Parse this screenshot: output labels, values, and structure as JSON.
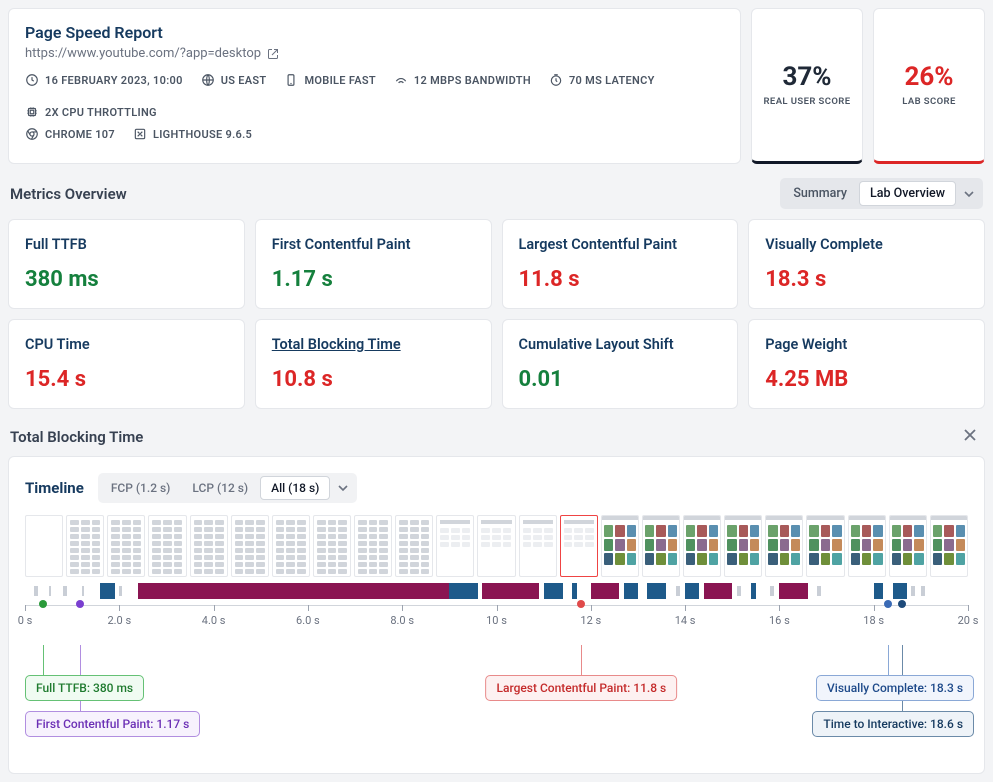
{
  "header": {
    "title": "Page Speed Report",
    "url": "https://www.youtube.com/?app=desktop",
    "meta1": [
      {
        "icon": "clock",
        "text": "16 FEBRUARY 2023, 10:00"
      },
      {
        "icon": "globe",
        "text": "US EAST"
      },
      {
        "icon": "device",
        "text": "MOBILE FAST"
      },
      {
        "icon": "speed",
        "text": "12 MBPS BANDWIDTH"
      },
      {
        "icon": "latency",
        "text": "70 MS LATENCY"
      },
      {
        "icon": "cpu",
        "text": "2X CPU THROTTLING"
      }
    ],
    "meta2": [
      {
        "icon": "chrome",
        "text": "CHROME 107"
      },
      {
        "icon": "lighthouse",
        "text": "LIGHTHOUSE 9.6.5"
      }
    ]
  },
  "scores": {
    "real": {
      "value": "37%",
      "label": "REAL USER SCORE"
    },
    "lab": {
      "value": "26%",
      "label": "LAB SCORE"
    }
  },
  "metrics_overview": {
    "title": "Metrics Overview",
    "tabs": {
      "summary": "Summary",
      "lab": "Lab Overview"
    }
  },
  "metrics": [
    {
      "name": "Full TTFB",
      "value": "380 ms",
      "color": "v-green"
    },
    {
      "name": "First Contentful Paint",
      "value": "1.17 s",
      "color": "v-green"
    },
    {
      "name": "Largest Contentful Paint",
      "value": "11.8 s",
      "color": "v-red"
    },
    {
      "name": "Visually Complete",
      "value": "18.3 s",
      "color": "v-red"
    },
    {
      "name": "CPU Time",
      "value": "15.4 s",
      "color": "v-red"
    },
    {
      "name": "Total Blocking Time",
      "value": "10.8 s",
      "color": "v-red",
      "underline": true
    },
    {
      "name": "Cumulative Layout Shift",
      "value": "0.01",
      "color": "v-green"
    },
    {
      "name": "Page Weight",
      "value": "4.25 MB",
      "color": "v-red"
    }
  ],
  "tbt": {
    "title": "Total Blocking Time",
    "timeline_label": "Timeline",
    "pills": {
      "fcp": "FCP (1.2 s)",
      "lcp": "LCP (12 s)",
      "all": "All (18 s)"
    }
  },
  "axis_ticks": [
    "0 s",
    "2.0 s",
    "4.0 s",
    "6.0 s",
    "8.0 s",
    "10 s",
    "12 s",
    "14 s",
    "16 s",
    "18 s",
    "20 s"
  ],
  "markers": {
    "ttfb": "Full TTFB: 380 ms",
    "fcp": "First Contentful Paint: 1.17 s",
    "lcp": "Largest Contentful Paint: 11.8 s",
    "vc": "Visually Complete: 18.3 s",
    "tti": "Time to Interactive: 18.6 s"
  },
  "chart_data": {
    "type": "table",
    "title": "Page Speed Report — YouTube desktop",
    "url": "https://www.youtube.com/?app=desktop",
    "test_config": {
      "date": "16 February 2023, 10:00",
      "location": "US East",
      "device": "Mobile Fast",
      "bandwidth_mbps": 12,
      "latency_ms": 70,
      "cpu_throttling": "2x",
      "browser": "Chrome 107",
      "lighthouse": "9.6.5"
    },
    "scores": {
      "real_user_score_pct": 37,
      "lab_score_pct": 26
    },
    "metrics": {
      "full_ttfb_ms": 380,
      "first_contentful_paint_s": 1.17,
      "largest_contentful_paint_s": 11.8,
      "visually_complete_s": 18.3,
      "cpu_time_s": 15.4,
      "total_blocking_time_s": 10.8,
      "cumulative_layout_shift": 0.01,
      "page_weight_mb": 4.25,
      "time_to_interactive_s": 18.6
    },
    "timeline_range_s": [
      0,
      20
    ],
    "timeline_markers": [
      {
        "name": "Full TTFB",
        "time_s": 0.38
      },
      {
        "name": "First Contentful Paint",
        "time_s": 1.17
      },
      {
        "name": "Largest Contentful Paint",
        "time_s": 11.8
      },
      {
        "name": "Visually Complete",
        "time_s": 18.3
      },
      {
        "name": "Time to Interactive",
        "time_s": 18.6
      }
    ]
  }
}
